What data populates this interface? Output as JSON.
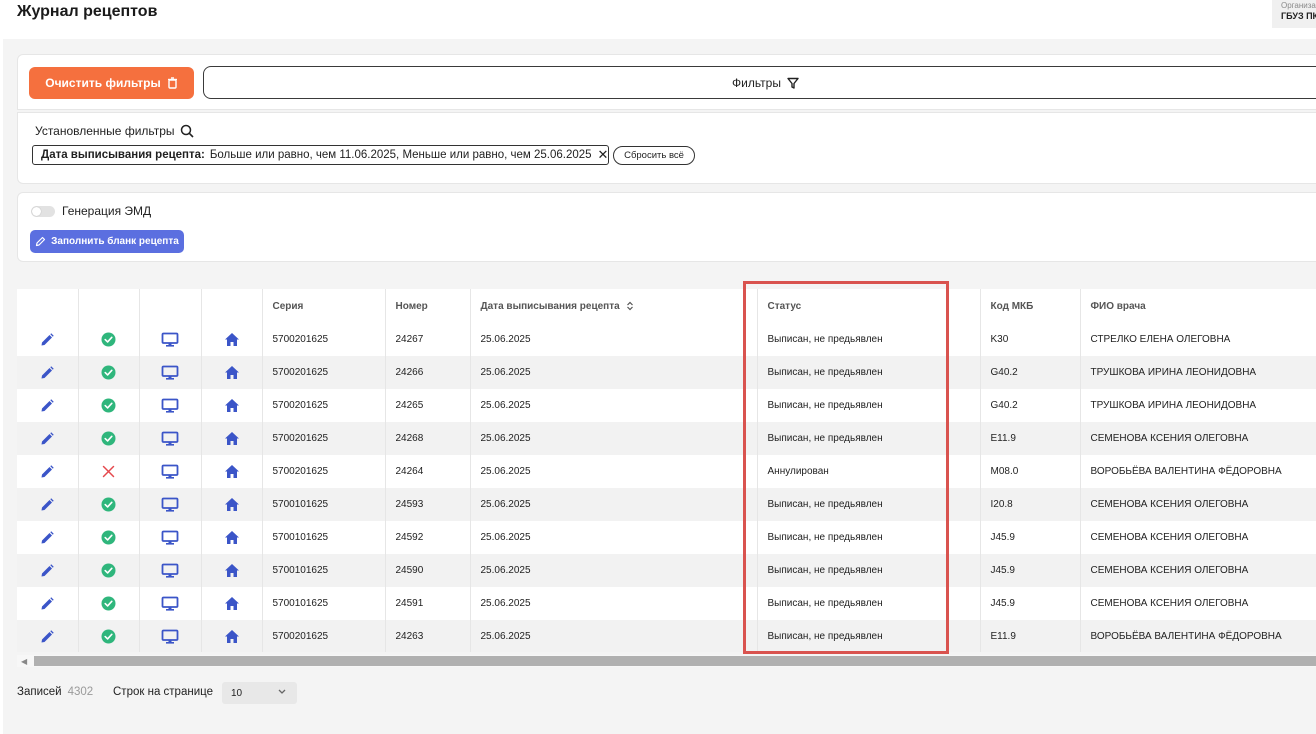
{
  "header": {
    "title": "Журнал рецептов",
    "org_label": "Организация",
    "org_value": "ГБУЗ ПК"
  },
  "toolbar": {
    "clear_label": "Очистить фильтры",
    "filters_label": "Фильтры"
  },
  "applied_filters": {
    "title": "Установленные фильтры",
    "chip_key": "Дата выписывания рецепта:",
    "chip_value": "Больше или равно, чем 11.06.2025, Меньше или равно, чем 25.06.2025",
    "reset_label": "Сбросить всё"
  },
  "emd": {
    "toggle_label": "Генерация ЭМД",
    "toggle_on": false,
    "fill_label": "Заполнить бланк рецепта"
  },
  "table": {
    "columns": [
      "",
      "",
      "",
      "",
      "Серия",
      "Номер",
      "Дата выписывания рецепта",
      "Статус",
      "Код МКБ",
      "ФИО врача"
    ],
    "rows": [
      {
        "status_icon": "check-circle-icon",
        "series": "5700201625",
        "number": "24267",
        "date": "25.06.2025",
        "status": "Выписан, не предьявлен",
        "mkb": "K30",
        "doctor": "СТРЕЛКО ЕЛЕНА ОЛЕГОВНА"
      },
      {
        "status_icon": "check-circle-icon",
        "series": "5700201625",
        "number": "24266",
        "date": "25.06.2025",
        "status": "Выписан, не предьявлен",
        "mkb": "G40.2",
        "doctor": "ТРУШКОВА ИРИНА ЛЕОНИДОВНА"
      },
      {
        "status_icon": "check-circle-icon",
        "series": "5700201625",
        "number": "24265",
        "date": "25.06.2025",
        "status": "Выписан, не предьявлен",
        "mkb": "G40.2",
        "doctor": "ТРУШКОВА ИРИНА ЛЕОНИДОВНА"
      },
      {
        "status_icon": "check-circle-icon",
        "series": "5700201625",
        "number": "24268",
        "date": "25.06.2025",
        "status": "Выписан, не предьявлен",
        "mkb": "E11.9",
        "doctor": "СЕМЕНОВА КСЕНИЯ ОЛЕГОВНА"
      },
      {
        "status_icon": "cross-icon",
        "series": "5700201625",
        "number": "24264",
        "date": "25.06.2025",
        "status": "Аннулирован",
        "mkb": "M08.0",
        "doctor": "ВОРОБЬЁВА ВАЛЕНТИНА ФЁДОРОВНА"
      },
      {
        "status_icon": "check-circle-icon",
        "series": "5700101625",
        "number": "24593",
        "date": "25.06.2025",
        "status": "Выписан, не предьявлен",
        "mkb": "I20.8",
        "doctor": "СЕМЕНОВА КСЕНИЯ ОЛЕГОВНА"
      },
      {
        "status_icon": "check-circle-icon",
        "series": "5700101625",
        "number": "24592",
        "date": "25.06.2025",
        "status": "Выписан, не предьявлен",
        "mkb": "J45.9",
        "doctor": "СЕМЕНОВА КСЕНИЯ ОЛЕГОВНА"
      },
      {
        "status_icon": "check-circle-icon",
        "series": "5700101625",
        "number": "24590",
        "date": "25.06.2025",
        "status": "Выписан, не предьявлен",
        "mkb": "J45.9",
        "doctor": "СЕМЕНОВА КСЕНИЯ ОЛЕГОВНА"
      },
      {
        "status_icon": "check-circle-icon",
        "series": "5700101625",
        "number": "24591",
        "date": "25.06.2025",
        "status": "Выписан, не предьявлен",
        "mkb": "J45.9",
        "doctor": "СЕМЕНОВА КСЕНИЯ ОЛЕГОВНА"
      },
      {
        "status_icon": "check-circle-icon",
        "series": "5700201625",
        "number": "24263",
        "date": "25.06.2025",
        "status": "Выписан, не предьявлен",
        "mkb": "E11.9",
        "doctor": "ВОРОБЬЁВА ВАЛЕНТИНА ФЁДОРОВНА"
      }
    ]
  },
  "footer": {
    "records_label": "Записей",
    "records_count": "4302",
    "rows_label": "Строк на странице",
    "rows_value": "10"
  },
  "colors": {
    "accent_orange": "#f5703e",
    "accent_blue": "#5b6fe0",
    "icon_blue": "#3b55c8",
    "success_green": "#2fb67c",
    "danger_red": "#e5484d",
    "highlight_red": "#d9534f"
  }
}
